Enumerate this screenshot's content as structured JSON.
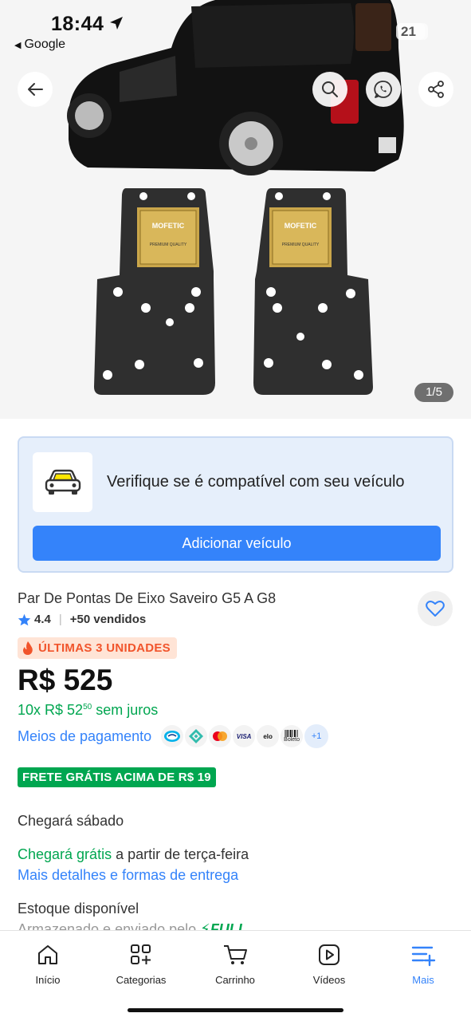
{
  "status_bar": {
    "time": "18:44",
    "back_app": "Google",
    "battery": "21"
  },
  "gallery": {
    "pager": "1/5",
    "plate_brand": "MOFETIC",
    "plate_quality": "PREMIUM QUALITY"
  },
  "compat": {
    "title": "Verifique se é compatível com seu veículo",
    "button_label": "Adicionar veículo"
  },
  "product": {
    "title": "Par De Pontas De Eixo Saveiro G5 A G8",
    "rating": "4.4",
    "sold": "+50 vendidos",
    "badge": "ÚLTIMAS 3 UNIDADES",
    "price": "R$ 525",
    "installments_prefix": "10x R$ 52",
    "installments_cents": "50",
    "installments_suffix": " sem juros",
    "payment_link": "Meios de pagamento",
    "payment_methods": [
      "mercado-pago",
      "pix",
      "mastercard",
      "VISA",
      "elo",
      "Boleto"
    ],
    "payment_more": "+1",
    "frete_badge": "FRETE GRÁTIS ACIMA DE R$ 19",
    "arrival": "Chegará sábado",
    "free_arrival_green": "Chegará grátis",
    "free_arrival_rest": " a partir de terça-feira",
    "more_details": "Mais detalhes e formas de entrega",
    "stock": "Estoque disponível",
    "stock_sub": "Armazenado e enviado pelo",
    "stock_full": "FULL"
  },
  "tabbar": {
    "items": [
      {
        "label": "Início",
        "icon": "home-icon"
      },
      {
        "label": "Categorias",
        "icon": "categories-icon"
      },
      {
        "label": "Carrinho",
        "icon": "cart-icon"
      },
      {
        "label": "Vídeos",
        "icon": "video-icon"
      },
      {
        "label": "Mais",
        "icon": "menu-plus-icon"
      }
    ],
    "active_index": 4
  },
  "colors": {
    "accent": "#3483fa",
    "green": "#00a650",
    "badge_orange": "#f1542b"
  }
}
